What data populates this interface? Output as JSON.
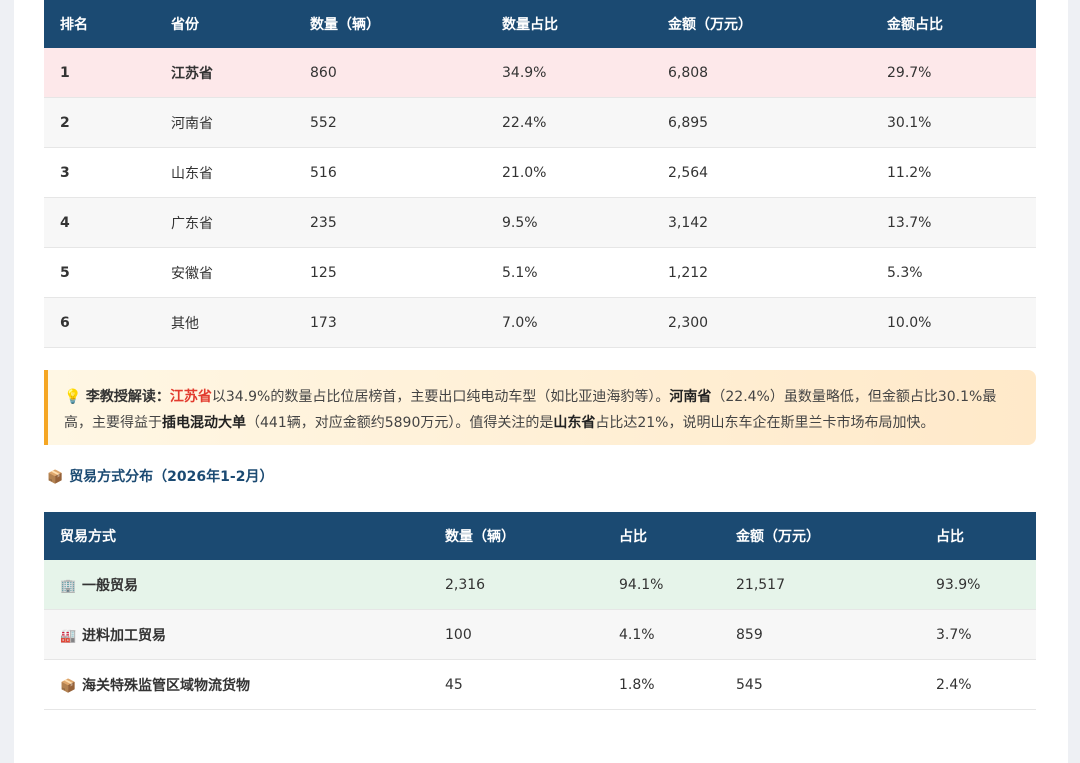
{
  "province_table": {
    "headers": [
      "排名",
      "省份",
      "数量（辆）",
      "数量占比",
      "金额（万元）",
      "金额占比"
    ],
    "rows": [
      {
        "rank": "1",
        "province": "江苏省",
        "qty": "860",
        "qty_share": "34.9%",
        "amount": "6,808",
        "amount_share": "29.7%"
      },
      {
        "rank": "2",
        "province": "河南省",
        "qty": "552",
        "qty_share": "22.4%",
        "amount": "6,895",
        "amount_share": "30.1%"
      },
      {
        "rank": "3",
        "province": "山东省",
        "qty": "516",
        "qty_share": "21.0%",
        "amount": "2,564",
        "amount_share": "11.2%"
      },
      {
        "rank": "4",
        "province": "广东省",
        "qty": "235",
        "qty_share": "9.5%",
        "amount": "3,142",
        "amount_share": "13.7%"
      },
      {
        "rank": "5",
        "province": "安徽省",
        "qty": "125",
        "qty_share": "5.1%",
        "amount": "1,212",
        "amount_share": "5.3%"
      },
      {
        "rank": "6",
        "province": "其他",
        "qty": "173",
        "qty_share": "7.0%",
        "amount": "2,300",
        "amount_share": "10.0%"
      }
    ]
  },
  "commentary": {
    "icon": "lightbulb-icon",
    "label": "李教授解读：",
    "p1_hl": "江苏省",
    "p2": "以34.9%的数量占比位居榜首，主要出口纯电动车型（如比亚迪海豹等）。",
    "p3_bold": "河南省",
    "p4": "（22.4%）虽数量略低，但金额占比30.1%最高，主要得益于",
    "p5_bold": "插电混动大单",
    "p6": "（441辆，对应金额约5890万元）。值得关注的是",
    "p7_bold": "山东省",
    "p8": "占比达21%，说明山东车企在斯里兰卡市场布局加快。"
  },
  "trade_section": {
    "icon": "package-icon",
    "title": "贸易方式分布（2026年1-2月）"
  },
  "trade_table": {
    "headers": [
      "贸易方式",
      "数量（辆）",
      "占比",
      "金额（万元）",
      "占比"
    ],
    "rows": [
      {
        "icon": "office-building-icon",
        "mode": "一般贸易",
        "qty": "2,316",
        "qty_share": "94.1%",
        "amount": "21,517",
        "amount_share": "93.9%"
      },
      {
        "icon": "factory-icon",
        "mode": "进料加工贸易",
        "qty": "100",
        "qty_share": "4.1%",
        "amount": "859",
        "amount_share": "3.7%"
      },
      {
        "icon": "package-icon",
        "mode": "海关特殊监管区域物流货物",
        "qty": "45",
        "qty_share": "1.8%",
        "amount": "545",
        "amount_share": "2.4%"
      }
    ]
  },
  "colors": {
    "header_bg": "#1b4a72",
    "highlight_red_row": "#fde8ea",
    "highlight_green_row": "#e6f4ea",
    "callout_accent": "#f5a623",
    "highlight_text": "#e23b2e"
  }
}
